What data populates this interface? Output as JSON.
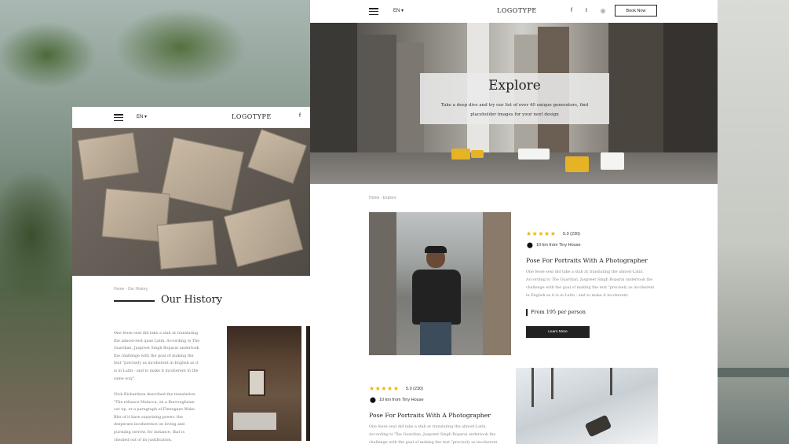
{
  "left_panel": {
    "nav": {
      "lang": "EN ▾",
      "logo": "LOGOTYPE",
      "social": "f"
    },
    "breadcrumb": "Home - Our History",
    "heading": "Our History",
    "paragraph1": "One fesse seul did take a stab at translating the almost-rest quae Latin. According to The Guardian, Jaspreet Singh Boparai undertook the challenge with the goal of making the text \"precisely as incoherent in English as it is in Latin - and to make it incoherent in the same way\".",
    "paragraph2": "Nick Richardson described the translation: \"The reliance Malacca, on a Burroughsian cut up, or a paragraph of Finnegans Wake. Bits of it have surprising power: the desperate incoherence on loving and pursuing sorrow, for instance, that is cheated out of its justification."
  },
  "main_panel": {
    "nav": {
      "lang": "EN ▾",
      "logo": "LOGOTYPE",
      "social": [
        "f",
        "t",
        "◎"
      ],
      "book": "Book Now"
    },
    "hero": {
      "title": "Explore",
      "subtitle": "Take a deep dive and try our list of over 40 unique generators, find placeholder images for your next design"
    },
    "breadcrumb": "Home - Explore",
    "card1": {
      "stars": "★★★★★",
      "rating": "5.0 (230)",
      "distance": "10 km from Tiny House",
      "title": "Pose For Portraits With A Photographer",
      "text": "One fesse seul did take a stab at translating the almost-Latin. According to The Guardian, Jaspreet Singh Boparai undertook the challenge with the goal of making the text \"precisely as incoherent in English as it is in Latin - and to make it incoherent.",
      "price": "From 195 per person",
      "button": "Learn More"
    },
    "card2": {
      "stars": "★★★★★",
      "rating": "5.0 (230)",
      "distance": "10 km from Tiny House",
      "title": "Pose For Portraits With A Photographer",
      "text": "One fesse seul did take a stab at translating the almost-Latin. According to The Guardian, Jaspreet Singh Boparai undertook the challenge with the goal of making the text \"precisely as incoherent"
    }
  },
  "colors": {
    "accent": "#222222",
    "star": "#f0b400"
  }
}
